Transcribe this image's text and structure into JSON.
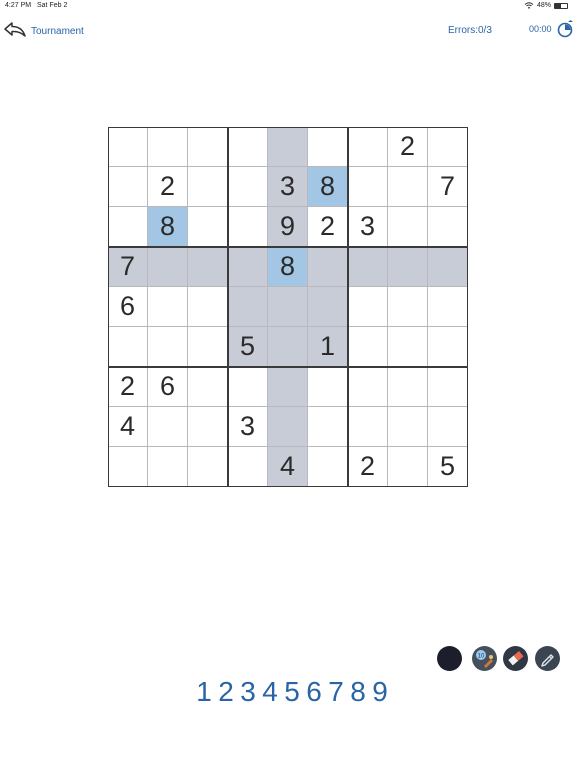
{
  "status_bar": {
    "time": "4:27 PM",
    "date": "Sat Feb 2",
    "battery_text": "48%",
    "battery_level": 0.48
  },
  "header": {
    "back_label": "Tournament",
    "errors": "Errors:0/3",
    "timer": "00:00"
  },
  "board": {
    "size": 9,
    "cells": [
      [
        "",
        "",
        "",
        "",
        "",
        "",
        "",
        "2",
        ""
      ],
      [
        "",
        "2",
        "",
        "",
        "3",
        "8",
        "",
        "",
        "7"
      ],
      [
        "",
        "8",
        "",
        "",
        "9",
        "2",
        "3",
        "",
        ""
      ],
      [
        "7",
        "",
        "",
        "",
        "8",
        "",
        "",
        "",
        ""
      ],
      [
        "6",
        "",
        "",
        "",
        "",
        "",
        "",
        "",
        ""
      ],
      [
        "",
        "",
        "",
        "5",
        "",
        "1",
        "",
        "",
        ""
      ],
      [
        "2",
        "6",
        "",
        "",
        "",
        "",
        "",
        "",
        ""
      ],
      [
        "4",
        "",
        "",
        "3",
        "",
        "",
        "",
        "",
        ""
      ],
      [
        "",
        "",
        "",
        "",
        "4",
        "",
        "2",
        "",
        "5"
      ]
    ],
    "selected_cell": {
      "row": 3,
      "col": 4
    },
    "same_value_cells": [
      {
        "row": 1,
        "col": 5
      },
      {
        "row": 2,
        "col": 1
      }
    ],
    "colors": {
      "highlight": "#c8ccd6",
      "selected": "#a2c6e4",
      "grid_line": "#b9b9bd",
      "box_line": "#3a3a3a"
    }
  },
  "tools": [
    {
      "name": "color-mode",
      "icon": "dark-circle-icon"
    },
    {
      "name": "hint",
      "icon": "hint-icon",
      "badge": "10"
    },
    {
      "name": "eraser",
      "icon": "eraser-icon"
    },
    {
      "name": "pencil",
      "icon": "pencil-icon"
    }
  ],
  "numpad": [
    "1",
    "2",
    "3",
    "4",
    "5",
    "6",
    "7",
    "8",
    "9"
  ],
  "accent_color": "#2a64a6"
}
